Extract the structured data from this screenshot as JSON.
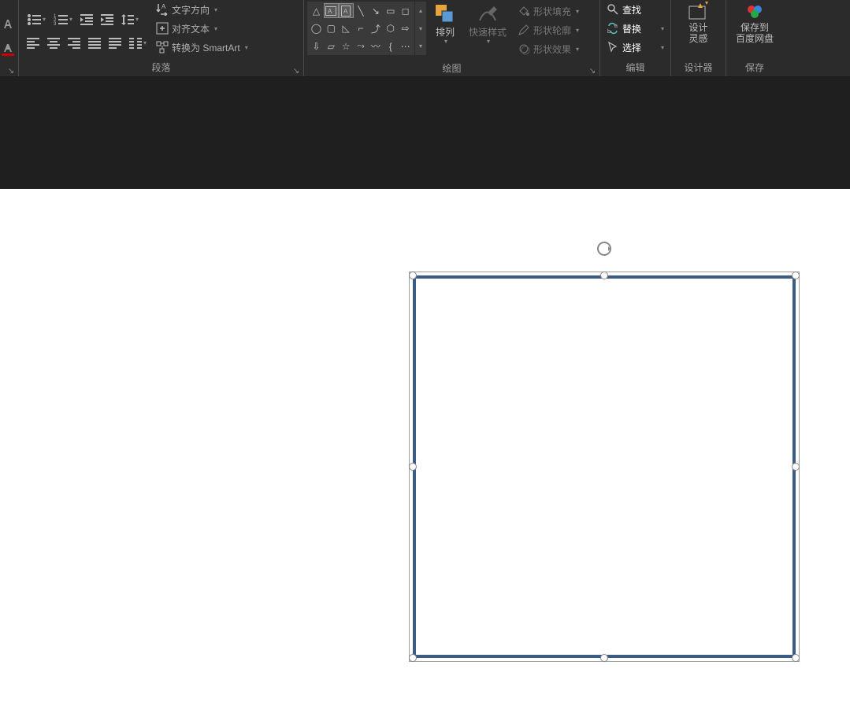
{
  "ribbon": {
    "paragraph": {
      "label": "段落",
      "text_direction": "文字方向",
      "align_text": "对齐文本",
      "convert_smartart": "转换为 SmartArt"
    },
    "drawing": {
      "label": "绘图",
      "arrange": "排列",
      "quick_styles": "快速样式",
      "shape_fill": "形状填充",
      "shape_outline": "形状轮廓",
      "shape_effects": "形状效果"
    },
    "editing": {
      "label": "编辑",
      "find": "查找",
      "replace": "替换",
      "select": "选择"
    },
    "designer": {
      "label": "设计器",
      "design_ideas_l1": "设计",
      "design_ideas_l2": "灵感"
    },
    "save": {
      "label": "保存",
      "save_to_l1": "保存到",
      "save_to_l2": "百度网盘"
    }
  }
}
